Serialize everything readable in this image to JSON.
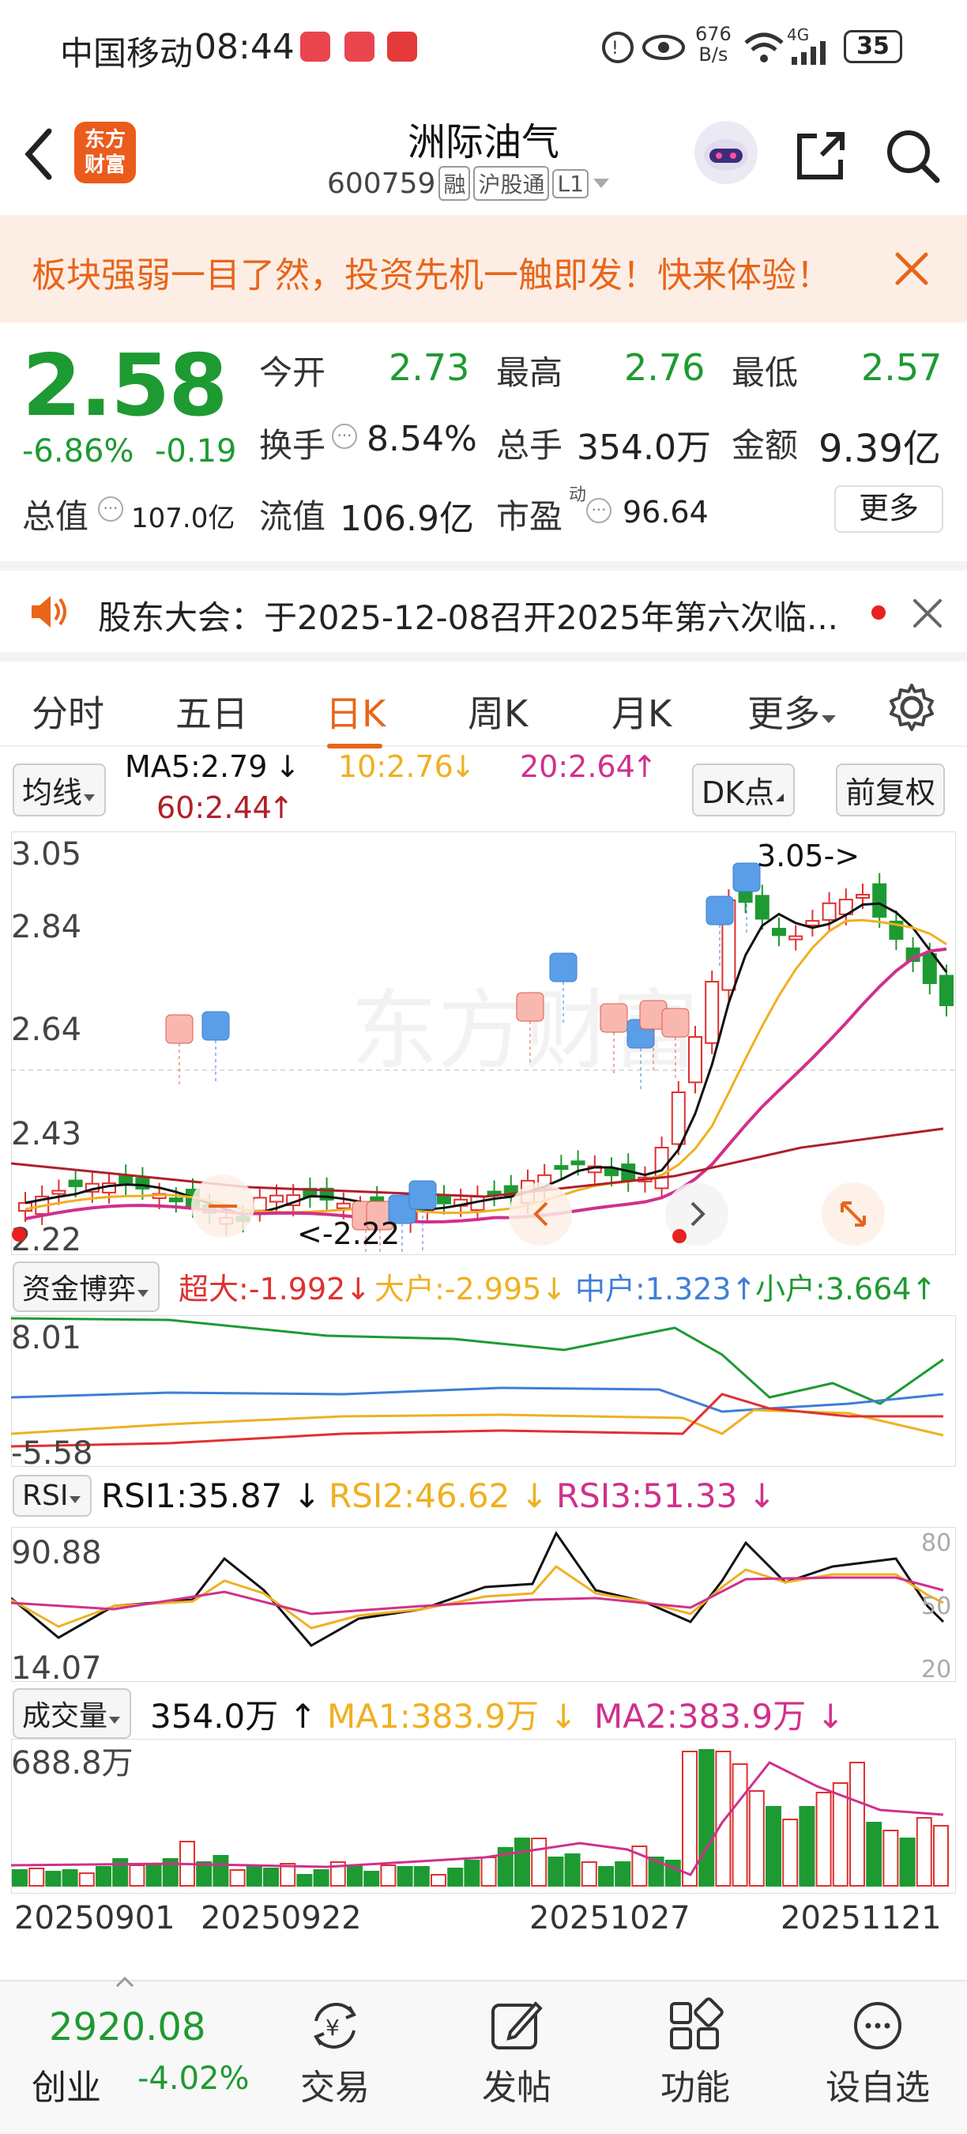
{
  "status": {
    "carrier": "中国移动",
    "time": "08:44",
    "net_speed_top": "676",
    "net_speed_bottom": "B/s",
    "signal_label": "4G",
    "battery": "35"
  },
  "header": {
    "brand_line1": "东方",
    "brand_line2": "财富",
    "title": "洲际油气",
    "code": "600759",
    "tag_rong": "融",
    "tag_hgt": "沪股通",
    "tag_level": "L1"
  },
  "banner": {
    "text": "板块强弱一目了然，投资先机一触即发！快来体验！"
  },
  "quote": {
    "price": "2.58",
    "change_pct": "-6.86%",
    "change": "-0.19",
    "open_label": "今开",
    "open": "2.73",
    "high_label": "最高",
    "high": "2.76",
    "low_label": "最低",
    "low": "2.57",
    "turnover_label": "换手",
    "turnover": "8.54%",
    "volume_label": "总手",
    "volume": "354.0万",
    "amount_label": "金额",
    "amount": "9.39亿",
    "mktcap_label": "总值",
    "mktcap": "107.0亿",
    "float_label": "流值",
    "float": "106.9亿",
    "pe_label": "市盈",
    "pe_sup": "动",
    "pe": "96.64",
    "more": "更多"
  },
  "notice": {
    "text": "股东大会：于2025-12-08召开2025年第六次临..."
  },
  "tabs": [
    "分时",
    "五日",
    "日K",
    "周K",
    "月K",
    "更多"
  ],
  "active_tab": 2,
  "ma": {
    "selector": "均线",
    "ma5": "MA5:2.79",
    "ma10": "10:2.76",
    "ma20": "20:2.64",
    "ma60": "60:2.44",
    "dk": "DK点",
    "adjust": "前复权"
  },
  "kline": {
    "y_top": "3.05",
    "y_2": "2.84",
    "y_3": "2.64",
    "y_4": "2.43",
    "y_bottom": "2.22",
    "max_note": "3.05->",
    "min_note": "<-2.22"
  },
  "fund": {
    "selector": "资金博弈",
    "super": "超大:-1.992",
    "big": "大户:-2.995",
    "mid": "中户:1.323",
    "small": "小户:3.664",
    "y_top": "8.01",
    "y_bottom": "-5.58"
  },
  "rsi": {
    "selector": "RSI",
    "rsi1": "RSI1:35.87",
    "rsi2": "RSI2:46.62",
    "rsi3": "RSI3:51.33",
    "y_top": "90.88",
    "y_bottom": "14.07",
    "r80": "80",
    "r50": "50",
    "r20": "20"
  },
  "vol": {
    "selector": "成交量",
    "value": "354.0万",
    "ma1": "MA1:383.9万",
    "ma2": "MA2:383.9万",
    "y_top": "688.8万"
  },
  "dates": [
    "20250901",
    "20250922",
    "20251027",
    "20251121"
  ],
  "bottom": {
    "index_value": "2920.08",
    "index_name": "创业",
    "index_change": "-4.02%",
    "trade": "交易",
    "post": "发帖",
    "func": "功能",
    "watch": "设自选"
  },
  "colors": {
    "up": "#e03030",
    "down": "#1e9a32",
    "ma5": "#111111",
    "ma10": "#f0b020",
    "ma20": "#d0308c",
    "ma60": "#b0202a",
    "accent": "#e8651a",
    "blue": "#3d7fd8"
  }
}
